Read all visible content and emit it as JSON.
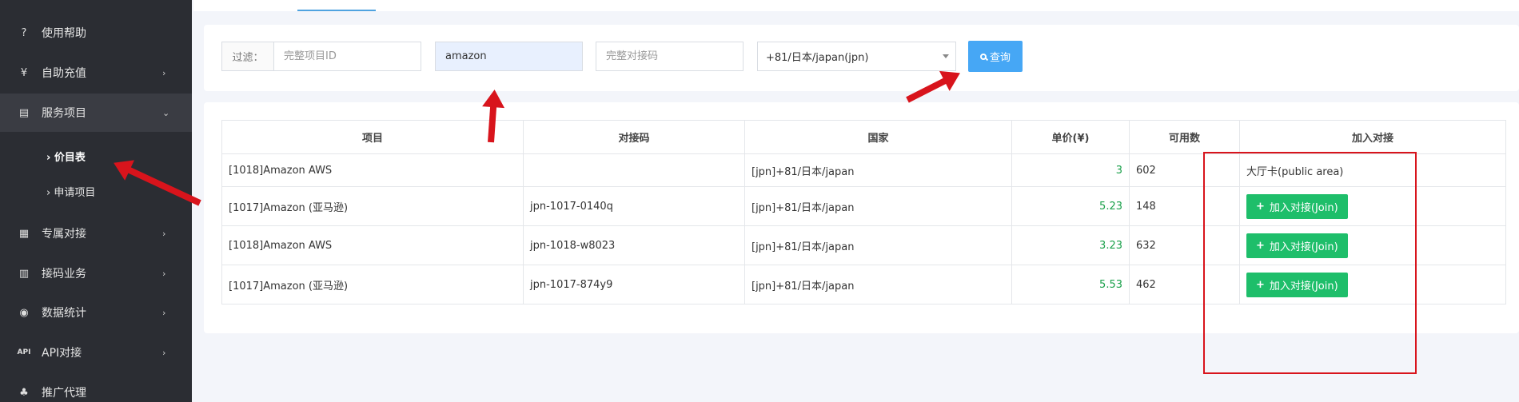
{
  "sidebar": {
    "items": [
      {
        "label": "使用帮助",
        "icon": "help-icon",
        "glyph": "?",
        "chevron": ""
      },
      {
        "label": "自助充值",
        "icon": "recharge-icon",
        "glyph": "¥",
        "chevron": "›"
      },
      {
        "label": "服务项目",
        "icon": "card-icon",
        "glyph": "▤",
        "chevron": "⌄"
      },
      {
        "label": "专属对接",
        "icon": "document-icon",
        "glyph": "▦",
        "chevron": "›"
      },
      {
        "label": "接码业务",
        "icon": "list-icon",
        "glyph": "▥",
        "chevron": "›"
      },
      {
        "label": "数据统计",
        "icon": "coins-icon",
        "glyph": "◉",
        "chevron": "›"
      },
      {
        "label": "API对接",
        "icon": "api-icon",
        "glyph": "API",
        "chevron": "›"
      },
      {
        "label": "推广代理",
        "icon": "sitemap-icon",
        "glyph": "♣",
        "chevron": ""
      }
    ],
    "subitems": [
      {
        "label": "› 价目表",
        "active": true
      },
      {
        "label": "› 申请项目",
        "active": false
      }
    ]
  },
  "filter": {
    "label": "过滤：",
    "project_id_placeholder": "完整项目ID",
    "keyword_value": "amazon",
    "code_placeholder": "完整对接码",
    "country_selected": "+81/日本/japan(jpn)",
    "query_label": "查询"
  },
  "table": {
    "headers": [
      "项目",
      "对接码",
      "国家",
      "单价(¥)",
      "可用数",
      "加入对接"
    ],
    "rows": [
      {
        "project": "[1018]Amazon AWS",
        "code": "",
        "country": "[jpn]+81/日本/japan",
        "price": "3",
        "available": "602",
        "action_text": "大厅卡(public area)",
        "action_button": ""
      },
      {
        "project": "[1017]Amazon (亚马逊)",
        "code": "jpn-1017-0140q",
        "country": "[jpn]+81/日本/japan",
        "price": "5.23",
        "available": "148",
        "action_text": "",
        "action_button": "加入对接(Join)"
      },
      {
        "project": "[1018]Amazon AWS",
        "code": "jpn-1018-w8023",
        "country": "[jpn]+81/日本/japan",
        "price": "3.23",
        "available": "632",
        "action_text": "",
        "action_button": "加入对接(Join)"
      },
      {
        "project": "[1017]Amazon (亚马逊)",
        "code": "jpn-1017-874y9",
        "country": "[jpn]+81/日本/japan",
        "price": "5.53",
        "available": "462",
        "action_text": "",
        "action_button": "加入对接(Join)"
      }
    ]
  },
  "colors": {
    "sidebar_bg": "#2b2d33",
    "query_button": "#46a7f5",
    "join_button": "#1ebe6a",
    "price_text": "#1aa04a",
    "annotation": "#d8141c"
  }
}
